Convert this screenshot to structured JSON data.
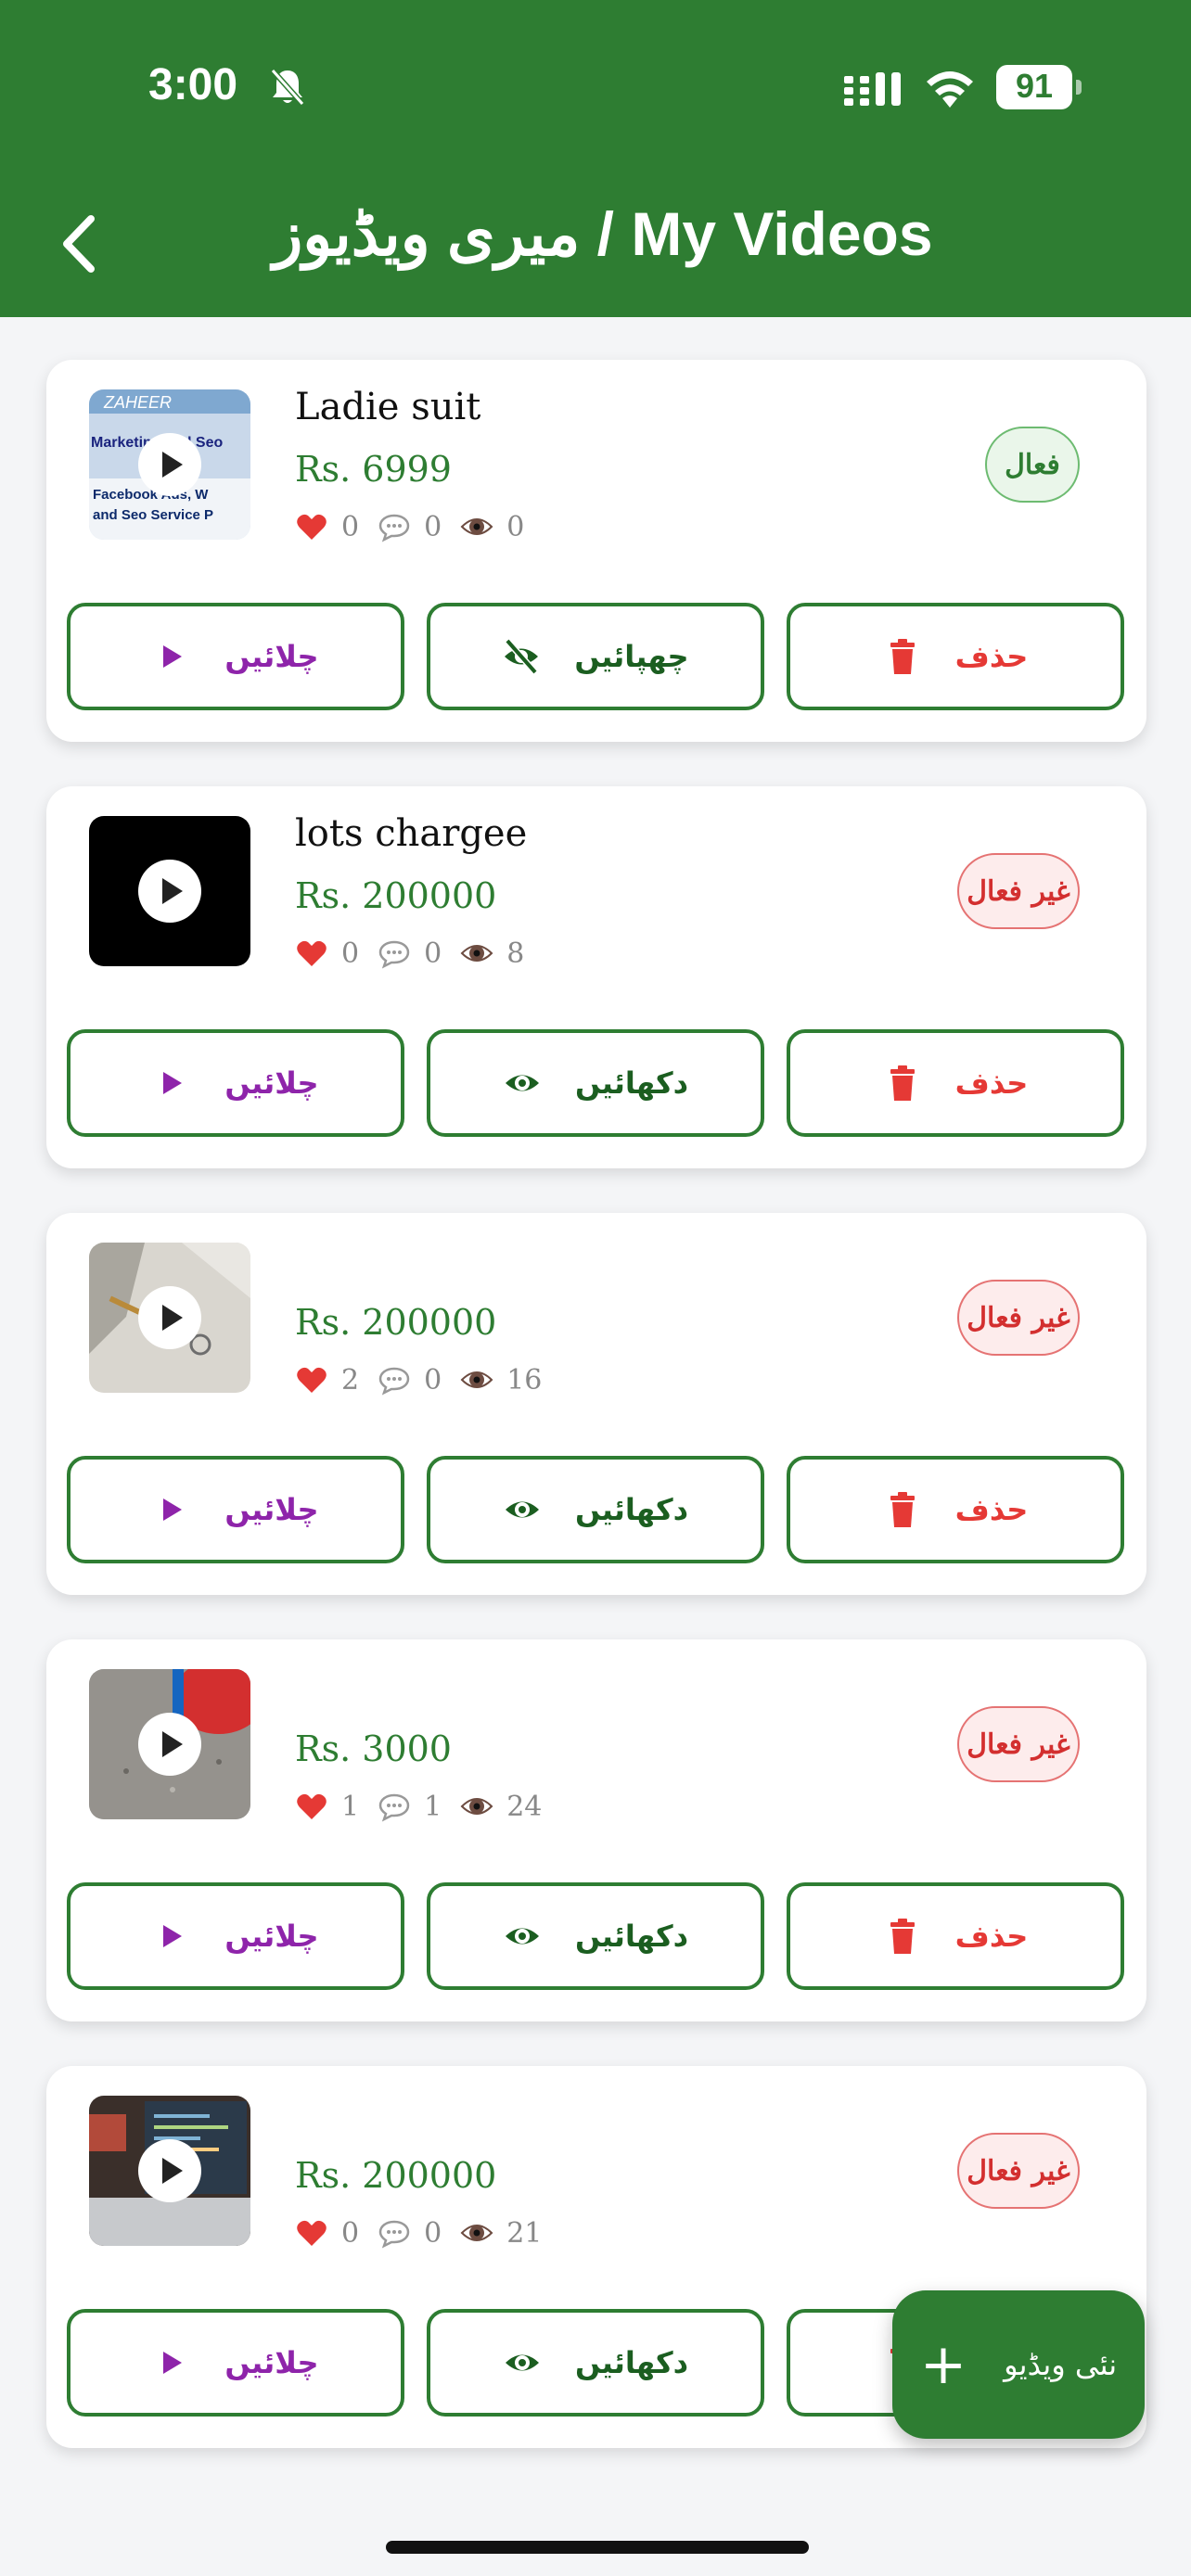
{
  "status_bar": {
    "time": "3:00",
    "battery": "91"
  },
  "header": {
    "title": "میری ویڈیوز / My Videos"
  },
  "labels": {
    "play": "چلائیں",
    "hide": "چھپائیں",
    "show": "دکھائیں",
    "delete": "حذف",
    "active": "فعال",
    "inactive": "غیر فعال"
  },
  "videos": [
    {
      "name": "Ladie suit",
      "price": "Rs. 6999",
      "likes": "0",
      "comments": "0",
      "views": "0",
      "status": "فعال",
      "visibility_action": "چھپائیں"
    },
    {
      "name": "lots chargee",
      "price": "Rs. 200000",
      "likes": "0",
      "comments": "0",
      "views": "8",
      "status": "غیر فعال",
      "visibility_action": "دکھائیں"
    },
    {
      "name": "",
      "price": "Rs. 200000",
      "likes": "2",
      "comments": "0",
      "views": "16",
      "status": "غیر فعال",
      "visibility_action": "دکھائیں"
    },
    {
      "name": "",
      "price": "Rs. 3000",
      "likes": "1",
      "comments": "1",
      "views": "24",
      "status": "غیر فعال",
      "visibility_action": "دکھائیں"
    },
    {
      "name": "",
      "price": "Rs. 200000",
      "likes": "0",
      "comments": "0",
      "views": "21",
      "status": "غیر فعال",
      "visibility_action": "دکھائیں"
    }
  ],
  "fab": {
    "label": "نئی ویڈیو"
  },
  "thumbnail_1_text": [
    "ZAHEER",
    "Marketing and Seo",
    "Facebook Ads, W",
    "and Seo Service P"
  ],
  "colors": {
    "primary": "#2e7d32",
    "play": "#8e24aa",
    "delete": "#e53935"
  }
}
